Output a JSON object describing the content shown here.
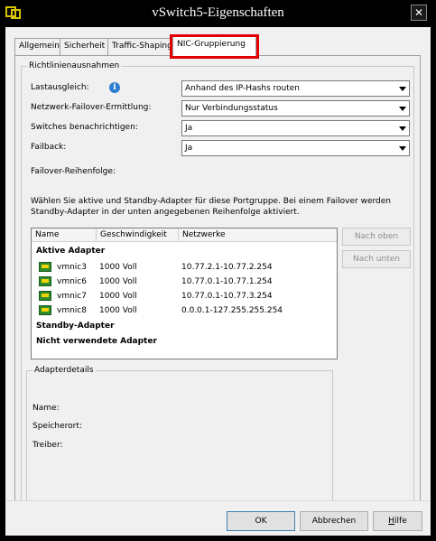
{
  "window": {
    "title": "vSwitch5-Eigenschaften",
    "close_glyph": "✕"
  },
  "tabs": [
    {
      "label": "Allgemein"
    },
    {
      "label": "Sicherheit"
    },
    {
      "label": "Traffic-Shaping"
    },
    {
      "label": "NIC-Gruppierung",
      "active": true
    }
  ],
  "policy": {
    "group_title": "Richtlinienausnahmen",
    "info_glyph": "i",
    "fields": [
      {
        "label": "Lastausgleich:",
        "value": "Anhand des IP-Hashs routen"
      },
      {
        "label": "Netzwerk-Failover-Ermittlung:",
        "value": "Nur Verbindungsstatus"
      },
      {
        "label": "Switches benachrichtigen:",
        "value": "Ja"
      },
      {
        "label": "Failback:",
        "value": "Ja"
      }
    ],
    "failover_order_label": "Failover-Reihenfolge:",
    "description": "Wählen Sie aktive und Standby-Adapter für diese Portgruppe. Bei einem Failover werden Standby-Adapter in der unten angegebenen Reihenfolge aktiviert."
  },
  "adapters": {
    "columns": [
      "Name",
      "Geschwindigkeit",
      "Netzwerke"
    ],
    "group_active": "Aktive Adapter",
    "group_standby": "Standby-Adapter",
    "group_unused": "Nicht verwendete Adapter",
    "active": [
      {
        "name": "vmnic3",
        "speed": "1000 Voll",
        "networks": "10.77.2.1-10.77.2.254"
      },
      {
        "name": "vmnic6",
        "speed": "1000 Voll",
        "networks": "10.77.0.1-10.77.1.254"
      },
      {
        "name": "vmnic7",
        "speed": "1000 Voll",
        "networks": "10.77.0.1-10.77.3.254"
      },
      {
        "name": "vmnic8",
        "speed": "1000 Voll",
        "networks": "0.0.0.1-127.255.255.254"
      }
    ],
    "move_up": "Nach oben",
    "move_down": "Nach unten"
  },
  "details": {
    "group_title": "Adapterdetails",
    "name_label": "Name:",
    "location_label": "Speicherort:",
    "driver_label": "Treiber:"
  },
  "footer": {
    "ok": "OK",
    "cancel": "Abbrechen",
    "help": "Hilfe"
  },
  "colors": {
    "highlight_border": "#e00000",
    "info_icon": "#2f7fd0",
    "nic_icon": "#2e8b2e"
  }
}
